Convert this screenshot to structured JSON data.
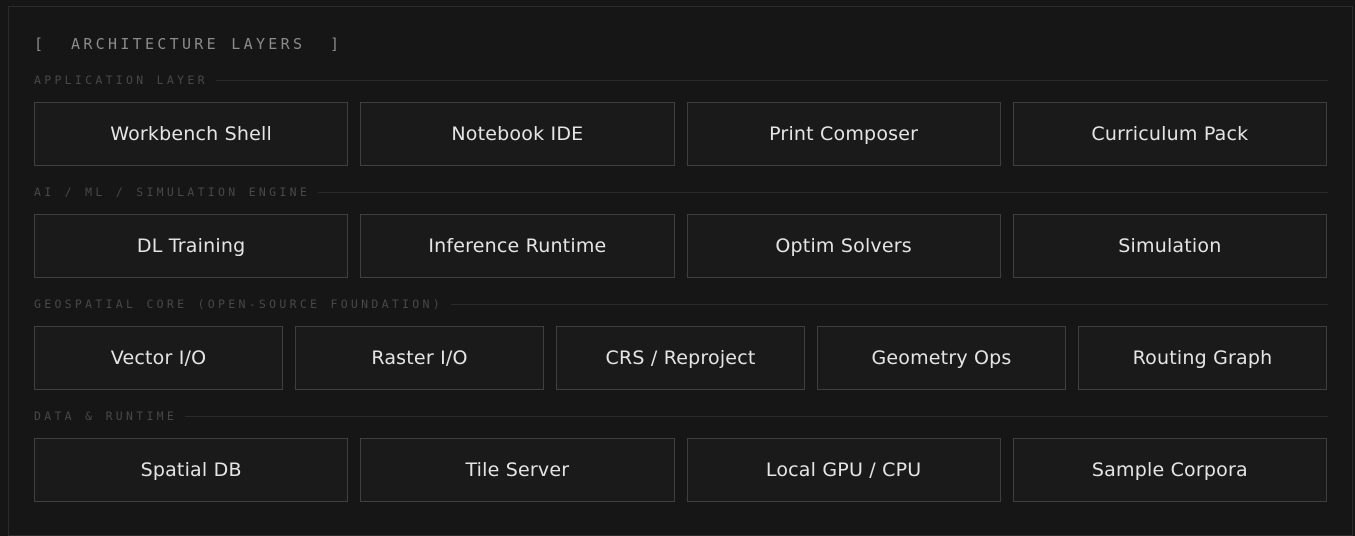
{
  "title": "[  ARCHITECTURE LAYERS  ]",
  "layers": [
    {
      "label": "APPLICATION LAYER",
      "items": [
        "Workbench Shell",
        "Notebook IDE",
        "Print Composer",
        "Curriculum Pack"
      ]
    },
    {
      "label": "AI / ML / SIMULATION ENGINE",
      "items": [
        "DL Training",
        "Inference Runtime",
        "Optim Solvers",
        "Simulation"
      ]
    },
    {
      "label": "GEOSPATIAL CORE (OPEN-SOURCE FOUNDATION)",
      "items": [
        "Vector I/O",
        "Raster I/O",
        "CRS / Reproject",
        "Geometry Ops",
        "Routing Graph"
      ]
    },
    {
      "label": "DATA & RUNTIME",
      "items": [
        "Spatial DB",
        "Tile Server",
        "Local GPU / CPU",
        "Sample Corpora"
      ]
    }
  ],
  "colors": {
    "background": "#161616",
    "tile_background": "#1a1a1a",
    "tile_border": "#3f3f3f",
    "tile_text": "#e4e4e4",
    "section_label": "#484848",
    "title_text": "#8b8b8b"
  }
}
